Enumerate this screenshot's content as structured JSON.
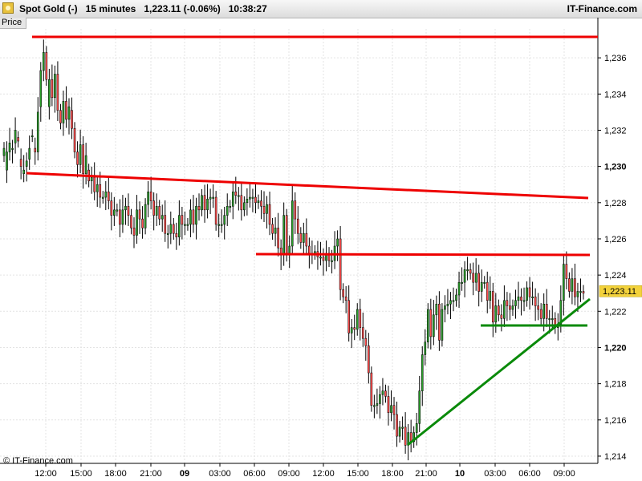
{
  "header": {
    "title": "Spot Gold (-)   15 minutes   1,223.11 (-0.06%)   10:38:27",
    "brand": "IT-Finance.com"
  },
  "panel": {
    "label": "Price"
  },
  "footer": {
    "credit": "© IT-Finance.com"
  },
  "colors": {
    "up": "#2a9e2a",
    "down": "#ff4d4d",
    "wick": "#000000",
    "resistance": "#ee0000",
    "support": "#0a8a0a",
    "last_price_bg": "#f3d23b"
  },
  "chart_data": {
    "type": "candlestick",
    "ylim": [
      1213.6,
      1237.6
    ],
    "y_ticks": [
      {
        "value": 1236,
        "label": "1,236",
        "bold": false
      },
      {
        "value": 1234,
        "label": "1,234",
        "bold": false
      },
      {
        "value": 1232,
        "label": "1,232",
        "bold": false
      },
      {
        "value": 1230,
        "label": "1,230",
        "bold": true
      },
      {
        "value": 1228,
        "label": "1,228",
        "bold": false
      },
      {
        "value": 1226,
        "label": "1,226",
        "bold": false
      },
      {
        "value": 1224,
        "label": "1,224",
        "bold": false
      },
      {
        "value": 1222,
        "label": "1,222",
        "bold": false
      },
      {
        "value": 1220,
        "label": "1,220",
        "bold": true
      },
      {
        "value": 1218,
        "label": "1,218",
        "bold": false
      },
      {
        "value": 1216,
        "label": "1,216",
        "bold": false
      },
      {
        "value": 1214,
        "label": "1,214",
        "bold": false
      }
    ],
    "x_ticks": [
      {
        "label": "12:00",
        "bold": false
      },
      {
        "label": "15:00",
        "bold": false
      },
      {
        "label": "18:00",
        "bold": false
      },
      {
        "label": "21:00",
        "bold": false
      },
      {
        "label": "09",
        "bold": true
      },
      {
        "label": "03:00",
        "bold": false
      },
      {
        "label": "06:00",
        "bold": false
      },
      {
        "label": "09:00",
        "bold": false
      },
      {
        "label": "12:00",
        "bold": false
      },
      {
        "label": "15:00",
        "bold": false
      },
      {
        "label": "18:00",
        "bold": false
      },
      {
        "label": "21:00",
        "bold": false
      },
      {
        "label": "10",
        "bold": true
      },
      {
        "label": "03:00",
        "bold": false
      },
      {
        "label": "06:00",
        "bold": false
      },
      {
        "label": "09:00",
        "bold": false
      }
    ],
    "close_path": [
      1231.0,
      1230.8,
      1231.3,
      1231.0,
      1232.0,
      1231.4,
      1230.0,
      1229.8,
      1230.3,
      1231.0,
      1231.7,
      1230.8,
      1233.0,
      1235.3,
      1236.3,
      1234.8,
      1234.8,
      1233.8,
      1235.1,
      1233.1,
      1232.4,
      1233.6,
      1232.6,
      1233.3,
      1232.1,
      1230.8,
      1230.1,
      1231.2,
      1229.6,
      1230.6,
      1229.2,
      1229.4,
      1228.6,
      1229.0,
      1228.3,
      1228.3,
      1228.6,
      1228.1,
      1227.3,
      1227.6,
      1227.6,
      1226.8,
      1227.6,
      1227.8,
      1227.3,
      1226.6,
      1226.2,
      1227.6,
      1227.1,
      1226.6,
      1227.9,
      1228.6,
      1228.1,
      1227.3,
      1227.8,
      1227.1,
      1227.3,
      1226.3,
      1226.3,
      1226.8,
      1226.3,
      1226.1,
      1227.3,
      1226.8,
      1226.8,
      1226.8,
      1227.6,
      1226.8,
      1227.8,
      1227.6,
      1228.4,
      1227.6,
      1228.2,
      1228.3,
      1228.3,
      1226.8,
      1226.8,
      1226.8,
      1227.3,
      1227.8,
      1227.8,
      1228.6,
      1228.4,
      1228.4,
      1227.6,
      1228.0,
      1228.2,
      1228.3,
      1228.3,
      1228.0,
      1228.1,
      1227.8,
      1227.4,
      1227.9,
      1226.8,
      1226.3,
      1226.6,
      1225.5,
      1225.1,
      1227.3,
      1225.1,
      1225.6,
      1228.1,
      1227.1,
      1226.3,
      1225.8,
      1226.3,
      1225.6,
      1225.2,
      1225.2,
      1225.3,
      1225.0,
      1225.0,
      1224.8,
      1225.2,
      1224.8,
      1224.8,
      1225.6,
      1226.0,
      1223.2,
      1222.8,
      1222.6,
      1220.8,
      1221.1,
      1221.0,
      1222.1,
      1221.1,
      1220.5,
      1220.1,
      1218.6,
      1216.8,
      1216.8,
      1216.9,
      1217.4,
      1217.6,
      1217.3,
      1216.4,
      1216.8,
      1216.3,
      1215.1,
      1215.6,
      1215.6,
      1214.6,
      1215.3,
      1214.8,
      1215.3,
      1215.8,
      1217.6,
      1219.6,
      1220.3,
      1222.1,
      1220.6,
      1221.8,
      1222.4,
      1220.4,
      1222.1,
      1222.3,
      1222.4,
      1222.6,
      1222.6,
      1222.9,
      1223.6,
      1223.6,
      1224.3,
      1224.3,
      1224.1,
      1223.6,
      1224.1,
      1223.1,
      1223.6,
      1223.6,
      1222.6,
      1223.1,
      1221.4,
      1222.3,
      1221.8,
      1221.6,
      1222.6,
      1222.3,
      1222.1,
      1222.3,
      1222.6,
      1222.8,
      1222.6,
      1222.6,
      1223.3,
      1222.8,
      1222.8,
      1222.3,
      1222.1,
      1221.6,
      1222.4,
      1221.6,
      1221.6,
      1221.6,
      1221.1,
      1221.3,
      1222.6,
      1224.6,
      1223.8,
      1223.1,
      1223.8,
      1222.8,
      1223.1,
      1223.1,
      1223.0
    ],
    "candle_range": [
      1230.6,
      1229.8,
      1230.8,
      1231.0,
      1231.3,
      1231.6,
      1230.4,
      1229.6,
      1230.0,
      1230.4,
      1231.7,
      1231.0,
      1230.8,
      1233.3,
      1235.3,
      1236.3,
      1233.3,
      1234.8,
      1233.8,
      1235.1,
      1233.1,
      1232.4,
      1233.6,
      1232.6,
      1233.1,
      1232.1,
      1230.8,
      1230.1,
      1231.2,
      1229.6,
      1229.8,
      1229.2,
      1229.4,
      1228.6,
      1229.0,
      1228.3,
      1228.3,
      1228.6,
      1228.1,
      1227.3,
      1227.6,
      1227.6,
      1226.8,
      1227.6,
      1227.8,
      1227.3,
      1226.6,
      1226.2,
      1227.6,
      1227.1,
      1226.6,
      1227.9,
      1228.6,
      1228.1,
      1227.3,
      1227.8,
      1227.1,
      1227.3,
      1226.3,
      1226.3,
      1226.8,
      1226.3,
      1226.1,
      1227.3,
      1226.8,
      1226.8,
      1226.8,
      1227.6,
      1226.8,
      1227.8,
      1227.6,
      1228.4,
      1227.6,
      1228.2,
      1228.3,
      1228.3,
      1226.8,
      1226.8,
      1226.8,
      1227.3,
      1227.8,
      1227.8,
      1228.6,
      1228.4,
      1228.4,
      1227.6,
      1228.0,
      1228.2,
      1228.3,
      1228.3,
      1228.0,
      1228.1,
      1227.8,
      1227.4,
      1227.9,
      1226.8,
      1226.3,
      1226.6,
      1225.5,
      1225.1,
      1227.3,
      1225.1,
      1225.6,
      1228.1,
      1227.1,
      1226.3,
      1225.8,
      1226.3,
      1225.6,
      1225.2,
      1225.2,
      1225.3,
      1225.0,
      1225.0,
      1224.8,
      1225.2,
      1224.8,
      1224.8,
      1225.6,
      1226.0,
      1223.2,
      1222.8,
      1222.6,
      1220.8,
      1221.1,
      1221.0,
      1222.1,
      1221.1,
      1220.5,
      1220.1,
      1218.6,
      1216.8,
      1216.8,
      1216.9,
      1217.4,
      1217.6,
      1217.3,
      1216.4,
      1216.8,
      1216.3,
      1215.1,
      1215.6,
      1215.6,
      1214.6,
      1215.3,
      1214.8,
      1215.3,
      1215.8,
      1217.6,
      1219.6,
      1220.3,
      1222.1,
      1220.6,
      1221.8,
      1222.4,
      1220.4,
      1222.1,
      1222.3,
      1222.4,
      1222.6,
      1222.6,
      1222.9,
      1223.6,
      1223.6,
      1224.3,
      1224.3,
      1224.1,
      1223.6,
      1224.1,
      1223.1,
      1223.6,
      1223.6,
      1222.6,
      1223.1,
      1221.4,
      1222.3,
      1221.8,
      1221.6,
      1222.6,
      1222.3,
      1222.1,
      1222.3,
      1222.6,
      1222.8,
      1222.6,
      1222.6,
      1223.3,
      1222.8,
      1222.8,
      1222.3,
      1222.1,
      1221.6,
      1222.4,
      1221.6,
      1221.6,
      1221.6,
      1221.1,
      1221.3,
      1222.6,
      1224.6,
      1223.8,
      1223.1,
      1223.8,
      1222.8,
      1223.1,
      1223.1
    ],
    "trendlines": [
      {
        "name": "top-resistance",
        "color": "#ee0000",
        "start": [
          0.0,
          1236.7
        ],
        "end": [
          1.0,
          1236.7
        ]
      },
      {
        "name": "descending-resistance",
        "color": "#ee0000",
        "start": [
          0.0,
          1229.2
        ],
        "end": [
          1.0,
          1227.9
        ]
      },
      {
        "name": "horizontal-resistance",
        "color": "#ee0000",
        "start": [
          0.4,
          1224.8
        ],
        "end": [
          1.0,
          1224.8
        ]
      },
      {
        "name": "horizontal-support",
        "color": "#0a8a0a",
        "start": [
          0.82,
          1220.9
        ],
        "end": [
          1.0,
          1220.9
        ]
      },
      {
        "name": "rising-support",
        "color": "#0a8a0a",
        "start": [
          0.69,
          1214.3
        ],
        "end": [
          1.0,
          1222.2
        ]
      }
    ],
    "last_price": {
      "value": 1223.11,
      "label": "1,223.11"
    }
  }
}
